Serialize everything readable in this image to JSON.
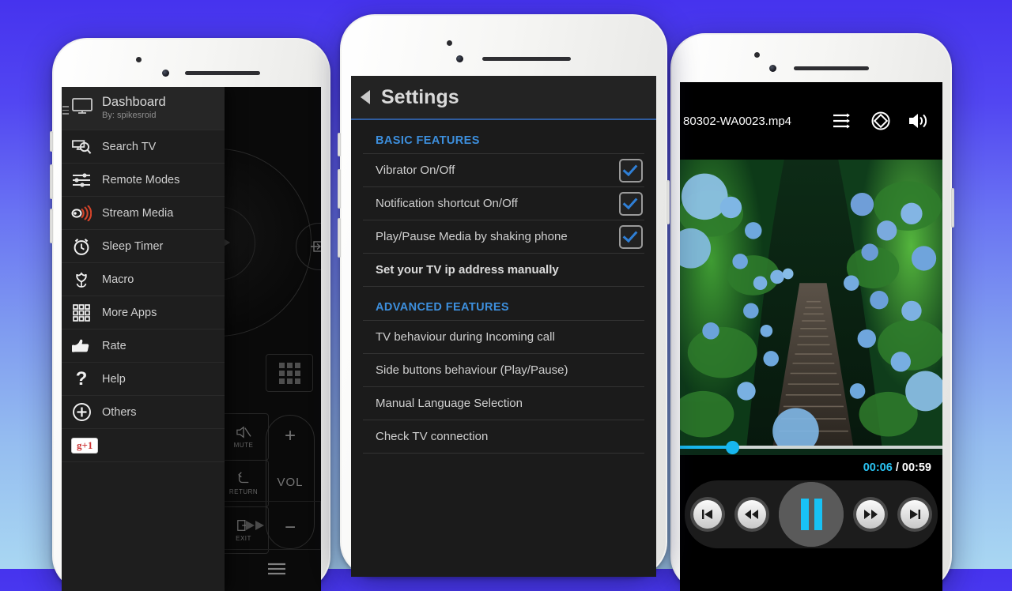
{
  "background": {
    "top_color": "#4633ee",
    "bottom_color": "#a9d7f2"
  },
  "accent": {
    "section_blue": "#3d8fdd",
    "check_blue": "#2f7fd6",
    "cyan": "#19b9ef"
  },
  "left_phone": {
    "app_drawer": {
      "header": {
        "title": "Dashboard",
        "subtitle": "By: spikesroid",
        "icon": "tv-monitor-icon"
      },
      "items": [
        {
          "label": "Search TV",
          "icon": "monitor-search-icon"
        },
        {
          "label": "Remote Modes",
          "icon": "sliders-icon"
        },
        {
          "label": "Stream Media",
          "icon": "cast-stream-icon"
        },
        {
          "label": "Sleep Timer",
          "icon": "alarm-clock-icon"
        },
        {
          "label": "Macro",
          "icon": "tulip-icon"
        },
        {
          "label": "More Apps",
          "icon": "grid-apps-icon"
        },
        {
          "label": "Rate",
          "icon": "thumbs-up-icon"
        },
        {
          "label": "Help",
          "icon": "question-mark-icon"
        },
        {
          "label": "Others",
          "icon": "plus-circle-icon"
        }
      ],
      "google_plus_badge": "g+1"
    },
    "remote": {
      "buttons": [
        {
          "label": "MUTE",
          "icon": "mute-icon"
        },
        {
          "label": "RETURN",
          "icon": "return-arrow-icon"
        },
        {
          "label": "EXIT",
          "icon": "exit-icon"
        }
      ],
      "volume": {
        "plus": "+",
        "label": "VOL",
        "minus": "−"
      },
      "bottom_icons": [
        "mic-icon",
        "star-icon",
        "menu-icon"
      ]
    }
  },
  "center_phone": {
    "header": {
      "back_icon": "back-arrow-icon",
      "title": "Settings"
    },
    "sections": [
      {
        "title": "BASIC FEATURES",
        "rows": [
          {
            "label": "Vibrator On/Off",
            "checkbox": true,
            "checked": true
          },
          {
            "label": "Notification shortcut On/Off",
            "checkbox": true,
            "checked": true
          },
          {
            "label": "Play/Pause Media by shaking phone",
            "checkbox": true,
            "checked": true
          },
          {
            "label": "Set your TV ip address manually",
            "checkbox": false,
            "bold": true
          }
        ]
      },
      {
        "title": "ADVANCED FEATURES",
        "rows": [
          {
            "label": "TV behaviour during Incoming call",
            "checkbox": false
          },
          {
            "label": "Side buttons behaviour (Play/Pause)",
            "checkbox": false
          },
          {
            "label": "Manual Language Selection",
            "checkbox": false
          },
          {
            "label": "Check TV connection",
            "checkbox": false
          }
        ]
      }
    ]
  },
  "right_phone": {
    "player": {
      "filename": "80302-WA0023.mp4",
      "top_icons": [
        "playlist-icon",
        "rotation-lock-icon",
        "volume-icon"
      ],
      "current_time": "00:06",
      "separator": "/",
      "total_time": "00:59",
      "progress_percent": 20,
      "transport": [
        "previous-icon",
        "rewind-icon",
        "pause-icon",
        "fast-forward-icon",
        "next-icon"
      ],
      "state": "playing"
    }
  }
}
